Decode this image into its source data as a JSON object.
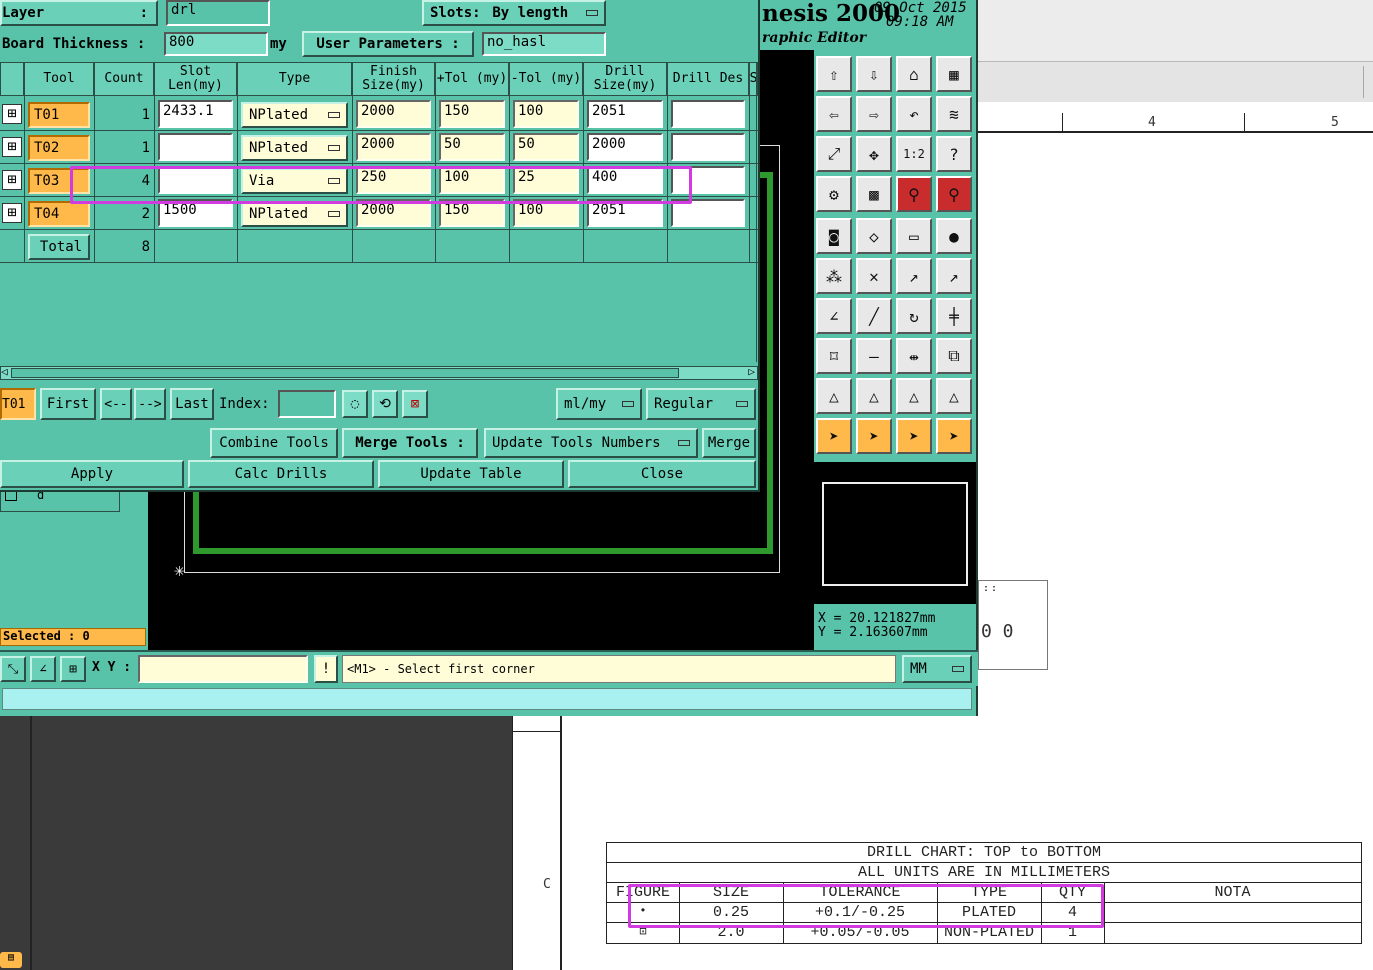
{
  "app": {
    "title_fragment": "nesis 2000",
    "subtitle_fragment": "raphic Editor",
    "date": "09 Oct 2015",
    "time": "09:18 AM"
  },
  "dialog": {
    "layer_label": "Layer",
    "layer_colon": ":",
    "layer_value": "drl",
    "slots_label": "Slots:",
    "slots_value": "By length",
    "board_thickness_label": "Board Thickness :",
    "board_thickness_value": "800",
    "board_thickness_unit": "my",
    "user_params_label": "User Parameters :",
    "user_params_value": "no_hasl",
    "columns": [
      "Tool",
      "Count",
      "Slot Len(my)",
      "Type",
      "Finish Size(my)",
      "+Tol (my)",
      "-Tol (my)",
      "Drill Size(my)",
      "Drill Des",
      "S"
    ],
    "rows": [
      {
        "tool": "T01",
        "count": "1",
        "slot_len": "2433.1",
        "type": "NPlated",
        "finish": "2000",
        "ptol": "150",
        "mtol": "100",
        "drill": "2051",
        "des": ""
      },
      {
        "tool": "T02",
        "count": "1",
        "slot_len": "",
        "type": "NPlated",
        "finish": "2000",
        "ptol": "50",
        "mtol": "50",
        "drill": "2000",
        "des": ""
      },
      {
        "tool": "T03",
        "count": "4",
        "slot_len": "",
        "type": "Via",
        "finish": "250",
        "ptol": "100",
        "mtol": "25",
        "drill": "400",
        "des": ""
      },
      {
        "tool": "T04",
        "count": "2",
        "slot_len": "1500",
        "type": "NPlated",
        "finish": "2000",
        "ptol": "150",
        "mtol": "100",
        "drill": "2051",
        "des": ""
      }
    ],
    "total_label": "Total",
    "total_count": "8",
    "nav": {
      "current": "T01",
      "first": "First",
      "prev": "<--",
      "next": "-->",
      "last": "Last",
      "index_label": "Index:",
      "units": "ml/my",
      "mode": "Regular"
    },
    "combine_tools": "Combine Tools",
    "merge_tools_label": "Merge Tools :",
    "update_tools_numbers": "Update Tools Numbers",
    "merge": "Merge",
    "apply": "Apply",
    "calc_drills": "Calc Drills",
    "update_table": "Update Table",
    "close": "Close"
  },
  "left_panel": {
    "selected": "Selected : 0",
    "small_label": "d"
  },
  "bottom_toolbar": {
    "xy_label": "X Y :",
    "xy_value": "",
    "bang": "!",
    "prompt": "<M1> - Select first corner",
    "units": "MM"
  },
  "coords": {
    "x": "X = 20.121827mm",
    "y": "Y = 2.163607mm"
  },
  "palette_icons": [
    "export-icon",
    "import-icon",
    "home-icon",
    "window-icon",
    "left-icon",
    "right-icon",
    "undo-icon",
    "layers-icon",
    "fit-icon",
    "zoom-icon",
    "ratio-icon",
    "help-icon",
    "settings-icon",
    "grid-icon",
    "drc-icon",
    "drc-icon",
    "flash-icon",
    "shape-icon",
    "ruler-icon",
    "dot-icon",
    "connect-icon",
    "cross-icon",
    "move-icon",
    "move-icon",
    "line-icon",
    "line-icon",
    "arc-icon",
    "split-icon",
    "pad-icon",
    "minus-icon",
    "measure-icon",
    "group-icon",
    "triangle-icon",
    "triangle-icon",
    "triangle-icon",
    "triangle-icon",
    "cursor-icon",
    "cursor-icon",
    "cursor-icon",
    "cursor-icon"
  ],
  "pdf": {
    "ruler_labels": [
      "4",
      "5"
    ],
    "side_letter": "C",
    "drill_chart": {
      "title": "DRILL CHART: TOP to BOTTOM",
      "subtitle": "ALL UNITS ARE IN MILLIMETERS",
      "headers": [
        "FIGURE",
        "SIZE",
        "TOLERANCE",
        "TYPE",
        "QTY",
        "NOTA"
      ],
      "rows": [
        {
          "figure": "•",
          "size": "0.25",
          "tolerance": "+0.1/-0.25",
          "type": "PLATED",
          "qty": "4",
          "nota": ""
        },
        {
          "figure": "⊡",
          "size": "2.0",
          "tolerance": "+0.05/-0.05",
          "type": "NON-PLATED",
          "qty": "1",
          "nota": ""
        }
      ]
    },
    "drawing_fragment": "0 0"
  }
}
